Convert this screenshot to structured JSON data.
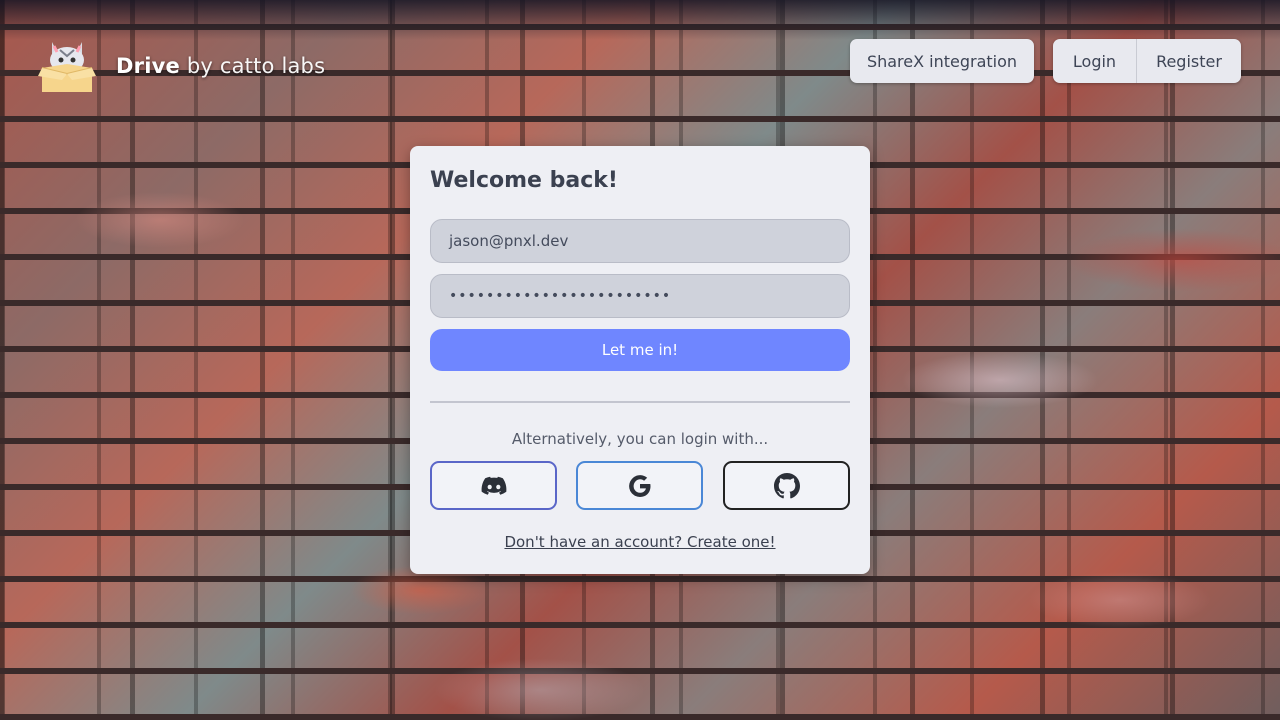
{
  "header": {
    "brand_name": "Drive",
    "brand_suffix": "by catto labs",
    "sharex_label": "ShareX integration",
    "login_label": "Login",
    "register_label": "Register"
  },
  "login_card": {
    "title": "Welcome back!",
    "email_value": "jason@pnxl.dev",
    "password_value": "••••••••••••••••••••••••",
    "submit_label": "Let me in!",
    "alt_text": "Alternatively, you can login with...",
    "oauth": [
      {
        "icon": "discord-icon",
        "color": "#5a66c8"
      },
      {
        "icon": "google-icon",
        "color": "#4a87d6"
      },
      {
        "icon": "github-icon",
        "color": "#222222"
      }
    ],
    "create_account_link": "Don't have an account? Create one!"
  },
  "colors": {
    "accent": "#6f86ff",
    "card_bg": "#eeeff4",
    "text_dark": "#3b4150"
  }
}
